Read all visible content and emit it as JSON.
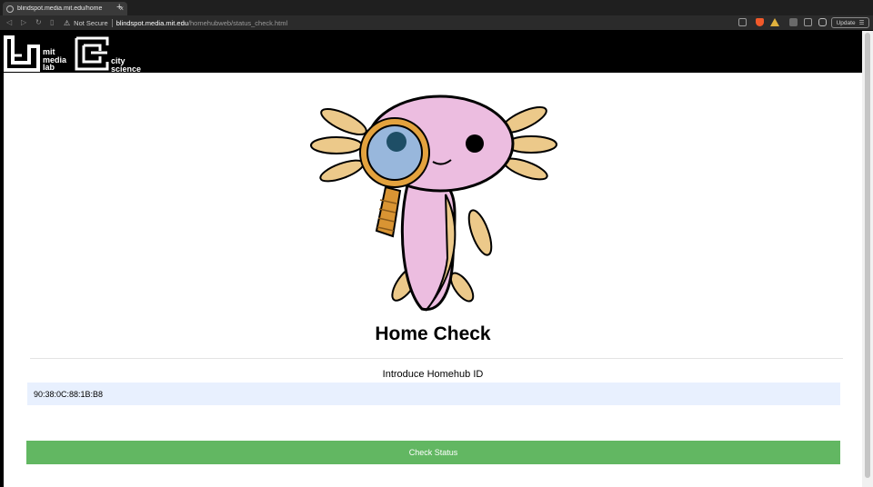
{
  "browser": {
    "tab_title": "blindspot.media.mit.edu/home",
    "tab_close": "×",
    "new_tab": "+",
    "security_label": "Not Secure",
    "url_host": "blindspot.media.mit.edu",
    "url_path": "/homehubweb/status_check.html",
    "update_label": "Update",
    "colors": {
      "brave": "#f1592a",
      "shield": "#e0b13d",
      "update_border": "#8a8a8a"
    }
  },
  "header": {
    "media_lab_text": [
      "mit",
      "media",
      "lab"
    ],
    "city_science_text": [
      "city",
      "science"
    ]
  },
  "page": {
    "title": "Home Check",
    "id_label": "Introduce Homehub ID",
    "id_value": "90:38:0C:88:1B:B8",
    "check_button": "Check Status",
    "colors": {
      "button": "#62b762",
      "input_bg": "#e8f0fe"
    }
  }
}
